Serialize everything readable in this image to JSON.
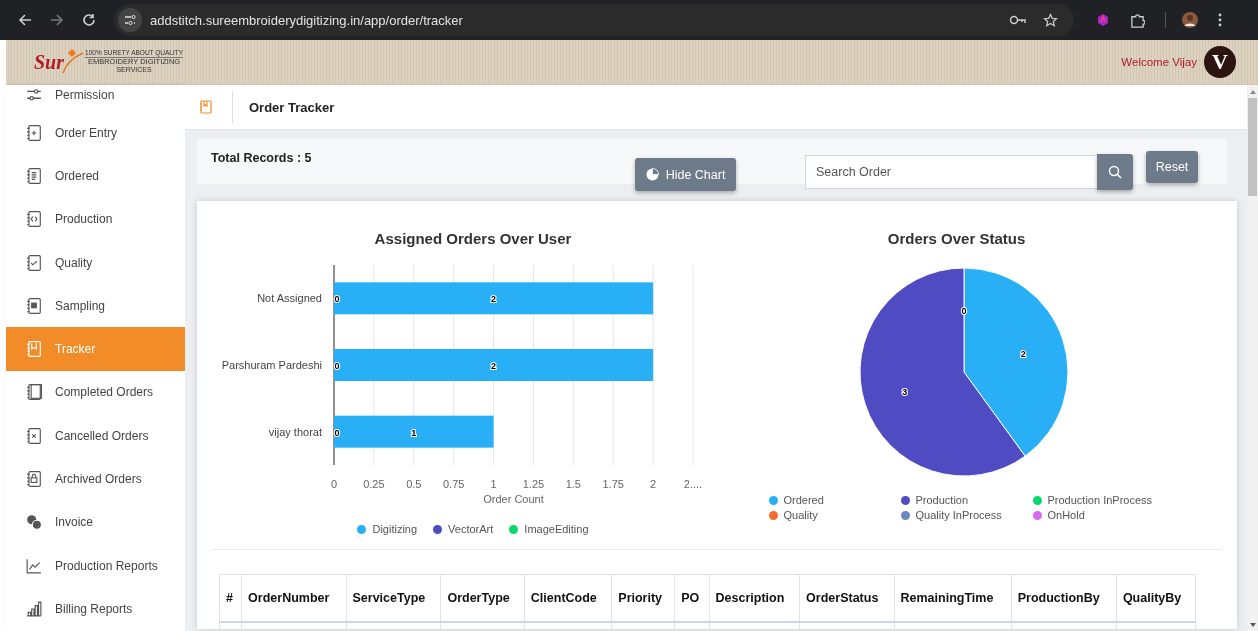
{
  "browser": {
    "url": "addstitch.sureembroiderydigitizing.in/app/order/tracker"
  },
  "header": {
    "logo": {
      "mark": "Sur",
      "tagline": "100% SURETY ABOUT QUALITY",
      "name": "EMBROIDERY DIGITIZING",
      "sub": "SERVICES"
    },
    "welcome": "Welcome Vijay",
    "avatar": "V"
  },
  "sidebar": {
    "items": [
      {
        "label": "Permission",
        "selected": false
      },
      {
        "label": "Order Entry",
        "selected": false
      },
      {
        "label": "Ordered",
        "selected": false
      },
      {
        "label": "Production",
        "selected": false
      },
      {
        "label": "Quality",
        "selected": false
      },
      {
        "label": "Sampling",
        "selected": false
      },
      {
        "label": "Tracker",
        "selected": true
      },
      {
        "label": "Completed Orders",
        "selected": false
      },
      {
        "label": "Cancelled Orders",
        "selected": false
      },
      {
        "label": "Archived Orders",
        "selected": false
      },
      {
        "label": "Invoice",
        "selected": false
      },
      {
        "label": "Production Reports",
        "selected": false
      },
      {
        "label": "Billing Reports",
        "selected": false
      }
    ]
  },
  "page": {
    "title": "Order Tracker"
  },
  "toolbar": {
    "total_records": "Total Records : 5",
    "hide_chart": "Hide Chart",
    "search": {
      "placeholder": "Search Order"
    },
    "reset": "Reset"
  },
  "charts": [
    {
      "chart_data": {
        "type": "bar",
        "orientation": "horizontal",
        "stacked": false,
        "title": "Assigned Orders Over User",
        "xlabel": "Order Count",
        "categories": [
          "Not Assigned",
          "Parshuram Pardeshi",
          "vijay thorat"
        ],
        "xlim": [
          0,
          2.25
        ],
        "xticks": [
          0,
          {
            "value": 0.25,
            "label": "0.25"
          },
          {
            "value": 0.5,
            "label": "0.5"
          },
          {
            "value": 0.75,
            "label": "0.75"
          },
          1,
          {
            "value": 1.25,
            "label": "1.25"
          },
          {
            "value": 1.5,
            "label": "1.5"
          },
          {
            "value": 1.75,
            "label": "1.75"
          },
          2,
          {
            "value": 2.25,
            "label": "2...."
          }
        ],
        "data_labels": true,
        "grid": true,
        "legend": true,
        "series": [
          {
            "name": "Digitizing",
            "color": "#29aff6",
            "values": [
              2,
              2,
              1
            ]
          },
          {
            "name": "VectorArt",
            "color": "#4f4bc2",
            "values": [
              0,
              0,
              0
            ]
          },
          {
            "name": "ImageEditing",
            "color": "#08d86a",
            "values": [
              null,
              null,
              null
            ]
          }
        ]
      }
    },
    {
      "chart_data": {
        "type": "pie",
        "title": "Orders Over Status",
        "value_labels": [
          "2",
          "3",
          "0",
          null,
          null,
          null
        ],
        "legend": true,
        "categories": [
          "Ordered",
          "Production",
          "Production InProcess",
          "Quality",
          "Quality InProcess",
          "OnHold"
        ],
        "values": [
          2,
          3,
          0,
          0,
          0,
          0
        ],
        "colors": [
          "#29aff6",
          "#4f4bc2",
          "#08d86a",
          "#fa6a30",
          "#6a87bd",
          "#d66af4"
        ]
      }
    }
  ],
  "table": {
    "columns": [
      "#",
      "OrderNumber",
      "ServiceType",
      "OrderType",
      "ClientCode",
      "Priority",
      "PO",
      "Description",
      "OrderStatus",
      "RemainingTime",
      "ProductionBy",
      "QualityBy"
    ]
  }
}
